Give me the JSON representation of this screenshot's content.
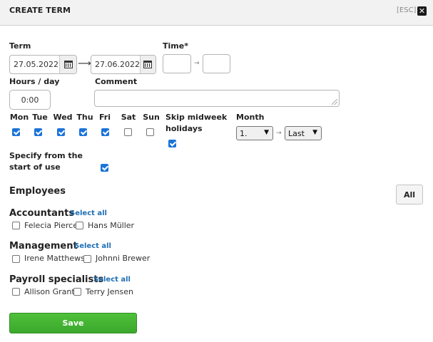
{
  "header": {
    "title": "CREATE TERM",
    "esc": "[ESC]",
    "close": "✕"
  },
  "form": {
    "term_label": "Term",
    "date_from": "27.05.2022",
    "date_to": "27.06.2022",
    "arrow": "⟶",
    "time_label": "Time*",
    "time_from": "",
    "time_to": "",
    "time_arrow": "→",
    "hours_label": "Hours / day",
    "hours_value": "0:00",
    "comment_label": "Comment",
    "comment_value": "",
    "days": [
      {
        "label": "Mon",
        "checked": true
      },
      {
        "label": "Tue",
        "checked": true
      },
      {
        "label": "Wed",
        "checked": true
      },
      {
        "label": "Thu",
        "checked": true
      },
      {
        "label": "Fri",
        "checked": true
      },
      {
        "label": "Sat",
        "checked": false
      },
      {
        "label": "Sun",
        "checked": false
      }
    ],
    "skip_label_1": "Skip midweek",
    "skip_label_2": "holidays",
    "skip_checked": true,
    "month_label": "Month",
    "month_from": "1.",
    "month_to": "Last",
    "month_arrow": "→",
    "specify_label_1": "Specify from the",
    "specify_label_2": "start of use",
    "specify_checked": true
  },
  "employees": {
    "title": "Employees",
    "all_label": "All",
    "select_all": "Select all",
    "groups": [
      {
        "name": "Accountants",
        "people": [
          "Felecia Pierce",
          "Hans Müller"
        ]
      },
      {
        "name": "Management",
        "people": [
          "Irene Matthews",
          "Johnni Brewer"
        ]
      },
      {
        "name": "Payroll specialists",
        "people": [
          "Allison Grant",
          "Terry Jensen"
        ]
      }
    ]
  },
  "save_label": "Save",
  "colors": {
    "accent": "#1a73d9",
    "save": "#3ba82c",
    "link": "#1f6fb5"
  }
}
